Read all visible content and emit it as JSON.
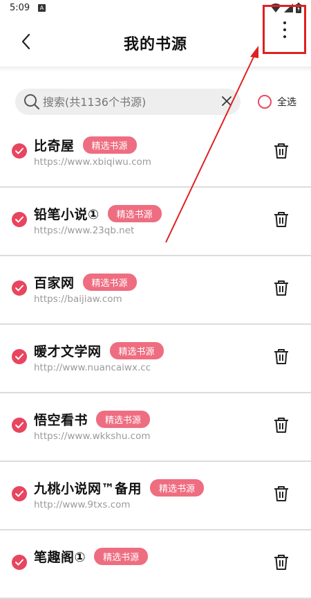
{
  "status_bar": {
    "time": "5:09",
    "notification_icon": "A"
  },
  "header": {
    "title": "我的书源",
    "back_icon": "chevron-left-icon",
    "more_icon": "more-vertical-icon"
  },
  "search": {
    "placeholder": "搜索(共1136个书源)",
    "value": ""
  },
  "select_all": {
    "label": "全选",
    "checked": false
  },
  "colors": {
    "accent": "#e8455f",
    "badge": "#ee6d80",
    "annotation": "#e02020"
  },
  "sources": [
    {
      "name": "比奇屋",
      "badge": "精选书源",
      "url": "https://www.xbiqiwu.com",
      "checked": true
    },
    {
      "name": "铅笔小说①",
      "badge": "精选书源",
      "url": "https://www.23qb.net",
      "checked": true
    },
    {
      "name": "百家网",
      "badge": "精选书源",
      "url": "https://baijiaw.com",
      "checked": true
    },
    {
      "name": "暖才文学网",
      "badge": "精选书源",
      "url": "http://www.nuancaiwx.cc",
      "checked": true
    },
    {
      "name": "悟空看书",
      "badge": "精选书源",
      "url": "https://www.wkkshu.com",
      "checked": true
    },
    {
      "name": "九桃小说网™备用",
      "badge": "精选书源",
      "url": "http://www.9txs.com",
      "checked": true
    },
    {
      "name": "笔趣阁①",
      "badge": "精选书源",
      "url": "",
      "checked": true
    }
  ]
}
